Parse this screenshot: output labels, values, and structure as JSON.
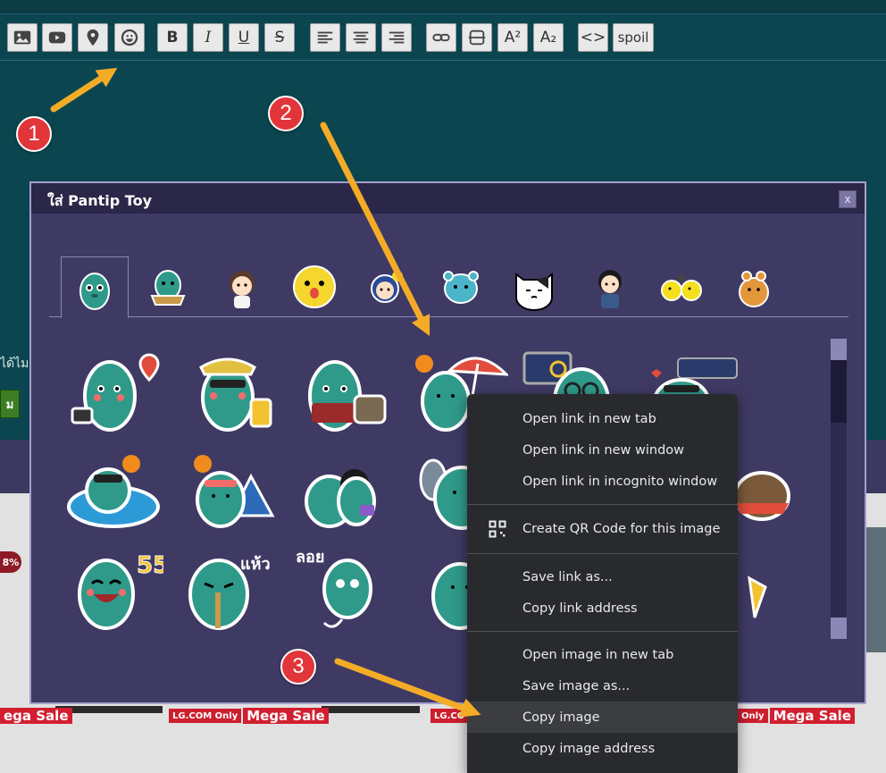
{
  "toolbar": {
    "buttons": [
      {
        "name": "insert-image",
        "icon": "image-icon"
      },
      {
        "name": "insert-video",
        "icon": "youtube-icon"
      },
      {
        "name": "insert-location",
        "icon": "map-pin-icon"
      },
      {
        "name": "insert-emoticon",
        "icon": "smiley-icon"
      },
      {
        "name": "bold",
        "icon": "bold-icon",
        "text": "B"
      },
      {
        "name": "italic",
        "icon": "italic-icon",
        "text": "I"
      },
      {
        "name": "underline",
        "icon": "underline-icon",
        "text": "U"
      },
      {
        "name": "strikethrough",
        "icon": "strikethrough-icon",
        "text": "S"
      },
      {
        "name": "align-left",
        "icon": "align-left-icon"
      },
      {
        "name": "align-center",
        "icon": "align-center-icon"
      },
      {
        "name": "align-right",
        "icon": "align-right-icon"
      },
      {
        "name": "link",
        "icon": "link-icon"
      },
      {
        "name": "horizontal-rule",
        "icon": "horizontal-rule-icon"
      },
      {
        "name": "superscript",
        "icon": "superscript-icon",
        "text": "A²"
      },
      {
        "name": "subscript",
        "icon": "subscript-icon",
        "text": "A₂"
      },
      {
        "name": "code",
        "icon": "code-icon",
        "text": "<>"
      },
      {
        "name": "spoiler",
        "text": "spoil"
      }
    ]
  },
  "background": {
    "side_text": "ได้ไม",
    "side_button": "ม",
    "discount_badge": "8%",
    "promo_lg": "LG.COM Only",
    "promo_mega": "Mega Sale",
    "promo_mega_left": "ega Sale",
    "promo_lg_short": "LG.CO"
  },
  "dialog": {
    "title": "ใส่ Pantip Toy",
    "close_label": "x",
    "sticker_sets": [
      "set-1-green-waving",
      "set-2-green-noodles",
      "set-3-girl",
      "set-4-yellow-face",
      "set-5-blue-bird",
      "set-6-blue-bear",
      "set-7-white-cat",
      "set-8-boy",
      "set-9-yellow-chicks",
      "set-10-orange-bear"
    ],
    "sticker_texts": [
      "55",
      "แห้ว",
      "ลอย"
    ]
  },
  "context_menu": {
    "items": [
      {
        "label": "Open link in new tab"
      },
      {
        "label": "Open link in new window"
      },
      {
        "label": "Open link in incognito window"
      },
      {
        "label": "Create QR Code for this image",
        "icon": "qr-code-icon"
      },
      {
        "label": "Save link as..."
      },
      {
        "label": "Copy link address"
      },
      {
        "label": "Open image in new tab"
      },
      {
        "label": "Save image as..."
      },
      {
        "label": "Copy image",
        "highlighted": true
      },
      {
        "label": "Copy image address"
      }
    ]
  },
  "annotations": {
    "step1": "1",
    "step2": "2",
    "step3": "3"
  },
  "colors": {
    "toolbar_bg": "#0b4650",
    "dialog_bg": "#3f3a64",
    "dialog_title_bg": "#2b2748",
    "menu_bg": "#292a2d",
    "arrow": "#f4ac27",
    "badge": "#e2353a",
    "sticker_green": "#2f9a8a"
  }
}
